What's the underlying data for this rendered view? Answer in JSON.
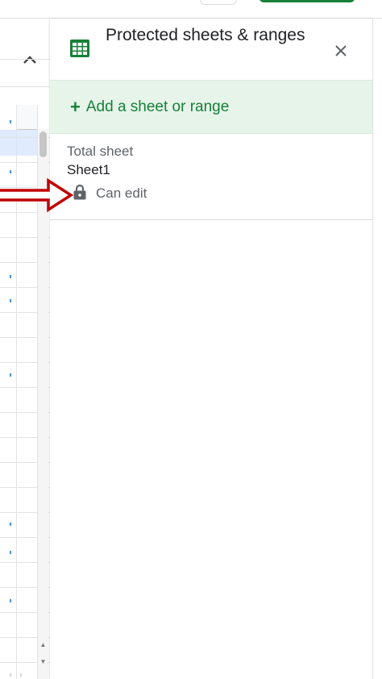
{
  "panel": {
    "title": "Protected sheets & ranges",
    "icon": "sheets-icon",
    "close_icon": "close-icon",
    "add_label": "Add a sheet or range",
    "add_icon": "plus-icon",
    "entries": [
      {
        "description": "Total sheet",
        "name": "Sheet1",
        "permission": "Can edit",
        "icon": "lock-icon"
      }
    ]
  },
  "sheet_strip": {
    "collapse_icon": "chevron-up-icon"
  },
  "annotation": {
    "icon": "red-arrow-icon"
  },
  "colors": {
    "accent_green": "#188038",
    "add_bar_bg": "#e6f4ea",
    "annotation_red": "#c00000",
    "text_primary": "#202124",
    "text_secondary": "#5f6368"
  }
}
